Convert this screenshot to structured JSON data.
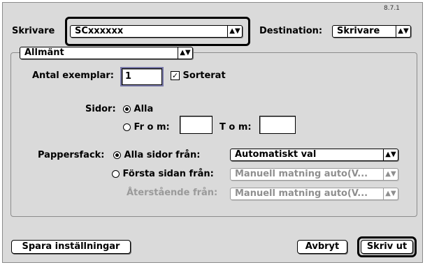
{
  "version": "8.7.1",
  "printer": {
    "label": "Skrivare",
    "value": "SCxxxxxx"
  },
  "destination": {
    "label": "Destination:",
    "value": "Skrivare"
  },
  "panel": {
    "value": "Allmänt"
  },
  "copies": {
    "label": "Antal exemplar:",
    "value": "1"
  },
  "collate": {
    "label": "Sorterat",
    "checked": true
  },
  "pages": {
    "label": "Sidor:",
    "all_label": "Alla",
    "from_label": "Fr o m:",
    "from_value": "",
    "to_label": "T o m:",
    "to_value": "",
    "selected": "all"
  },
  "paper_source": {
    "label": "Pappersfack:",
    "all_pages_label": "Alla sidor från:",
    "all_pages_value": "Automatiskt val",
    "first_page_label": "Första sidan från:",
    "first_page_value": "Manuell matning auto(V...",
    "remaining_label": "Återstående från:",
    "remaining_value": "Manuell matning auto(V...",
    "selected": "all"
  },
  "buttons": {
    "save": "Spara inställningar",
    "cancel": "Avbryt",
    "print": "Skriv ut"
  },
  "icons": {
    "popup_arrow": "up-down-arrows-icon",
    "checkmark": "checkmark-icon"
  }
}
